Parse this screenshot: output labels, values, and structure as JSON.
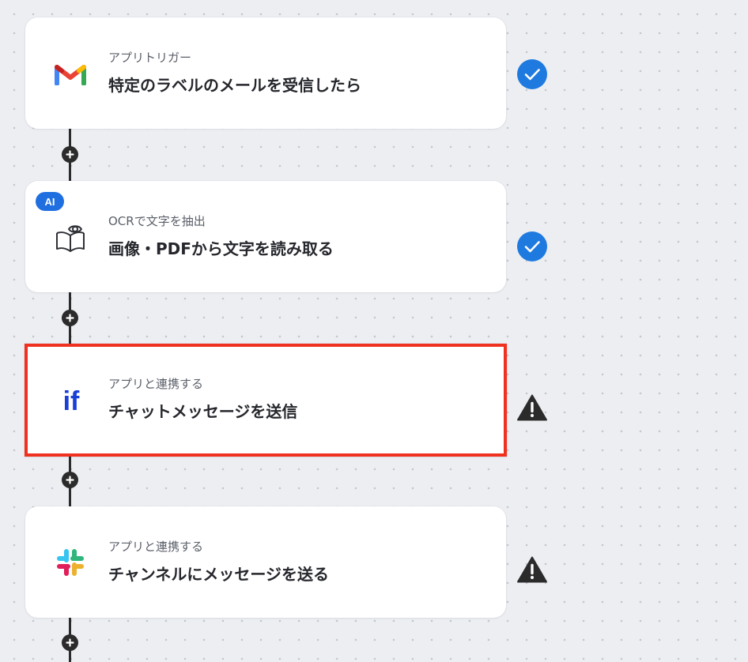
{
  "steps": [
    {
      "subtitle": "アプリトリガー",
      "title": "特定のラベルのメールを受信したら",
      "app_icon": "gmail-icon",
      "status": "complete-check-icon"
    },
    {
      "badge": "AI",
      "subtitle": "OCRで文字を抽出",
      "title": "画像・PDFから文字を読み取る",
      "app_icon": "ocr-book-eye-icon",
      "status": "complete-check-icon"
    },
    {
      "subtitle": "アプリと連携する",
      "title": "チャットメッセージを送信",
      "app_icon": "if-app-icon",
      "app_icon_text": "if",
      "status": "warning-icon",
      "selected": true
    },
    {
      "subtitle": "アプリと連携する",
      "title": "チャンネルにメッセージを送る",
      "app_icon": "slack-icon",
      "status": "warning-icon"
    }
  ],
  "colors": {
    "background": "#eceef2",
    "connector": "#2b2b2b",
    "check": "#1f7ae0",
    "warning": "#2b2b2b",
    "selected_border": "#f0311f",
    "ai_badge": "#1f6fe0",
    "if_brand": "#1a3fd6"
  }
}
